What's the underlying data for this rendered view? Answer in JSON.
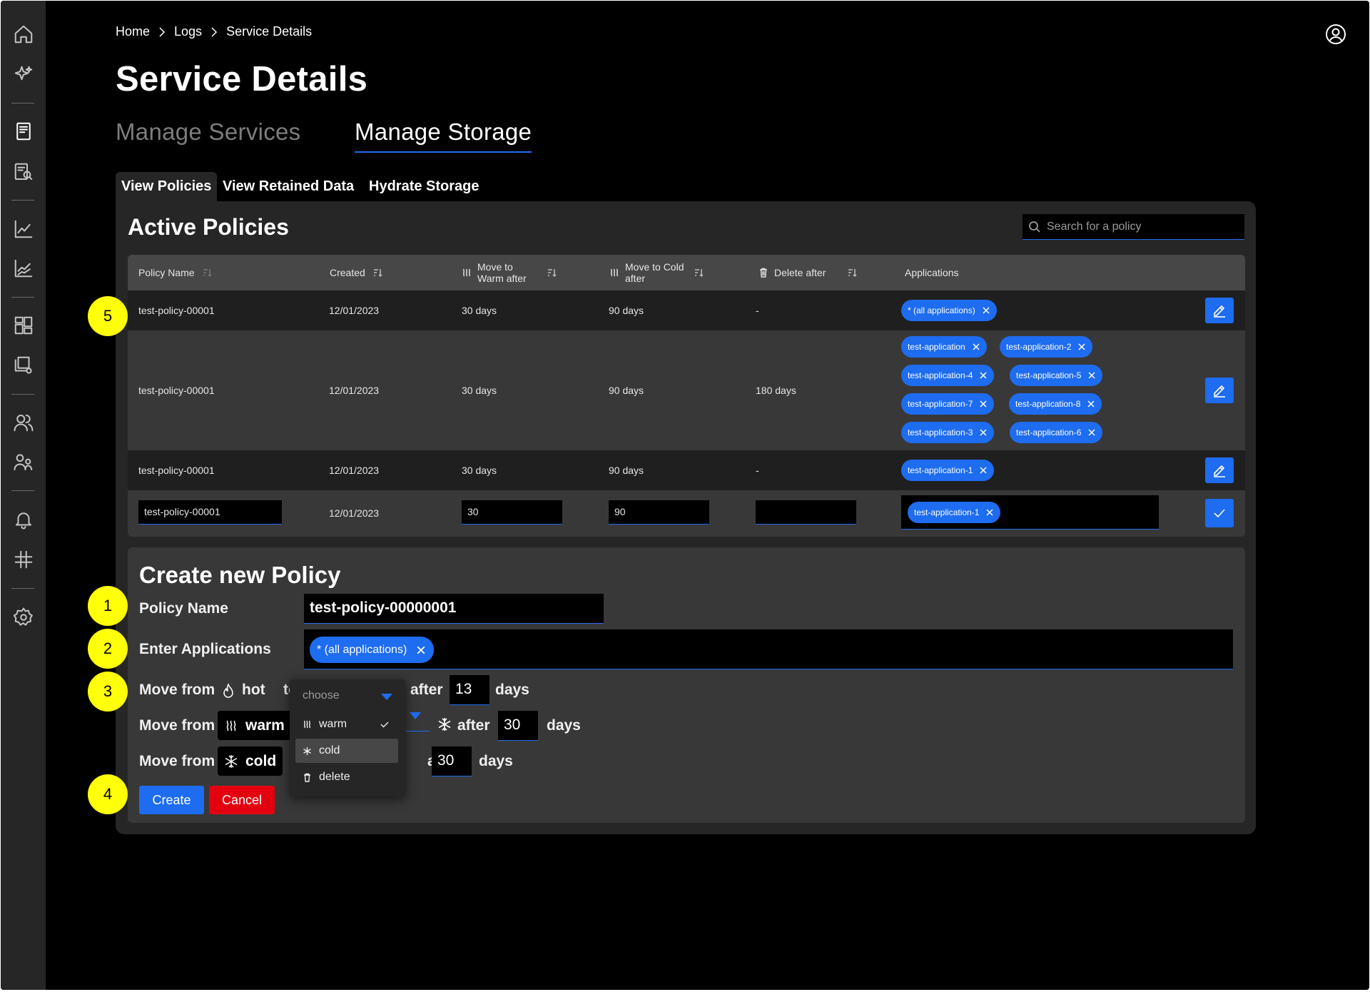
{
  "breadcrumb": [
    "Home",
    "Logs",
    "Service Details"
  ],
  "page_title": "Service Details",
  "main_tabs": [
    "Manage Services",
    "Manage Storage"
  ],
  "sub_tabs": [
    "View Policies",
    "View Retained Data",
    "Hydrate Storage"
  ],
  "active_policies": {
    "title": "Active Policies",
    "search_placeholder": "Search for a policy",
    "columns": {
      "policy_name": "Policy Name",
      "created": "Created",
      "warm_line1": "Move to",
      "warm_line2": "Warm after",
      "cold_line1": "Move to Cold",
      "cold_line2": "after",
      "delete_after": "Delete after",
      "applications": "Applications"
    },
    "rows": [
      {
        "name": "test-policy-00001",
        "created": "12/01/2023",
        "warm": "30 days",
        "cold": "90 days",
        "delete": "-",
        "apps": [
          "* (all applications)"
        ]
      },
      {
        "name": "test-policy-00001",
        "created": "12/01/2023",
        "warm": "30 days",
        "cold": "90 days",
        "delete": "180 days",
        "apps": [
          "test-application",
          "test-application-2",
          "test-application-4",
          "test-application-5",
          "test-application-7",
          "test-application-8",
          "test-application-3",
          "test-application-6"
        ]
      },
      {
        "name": "test-policy-00001",
        "created": "12/01/2023",
        "warm": "30 days",
        "cold": "90 days",
        "delete": "-",
        "apps": [
          "test-application-1"
        ]
      },
      {
        "name": "test-policy-00001",
        "created": "12/01/2023",
        "warm": "30",
        "cold": "90",
        "delete": "",
        "apps": [
          "test-application-1"
        ]
      }
    ]
  },
  "create_policy": {
    "title": "Create new Policy",
    "policy_name_label": "Policy Name",
    "policy_name_value": "test-policy-00000001",
    "applications_label": "Enter Applications",
    "applications": [
      "* (all applications)"
    ],
    "move_from": "Move from",
    "hot": "hot",
    "to": "to",
    "warm": "warm",
    "cold": "cold",
    "after": "after",
    "days": "days",
    "hot_after": "13",
    "warm_after": "30",
    "cold_after": "30",
    "create_label": "Create",
    "cancel_label": "Cancel"
  },
  "dropdown": {
    "placeholder": "choose",
    "options": [
      "warm",
      "cold",
      "delete"
    ],
    "checked": "warm",
    "highlighted": "cold"
  },
  "callouts": [
    "1",
    "2",
    "3",
    "4",
    "5"
  ],
  "colors": {
    "accent": "#1e6cf0",
    "danger": "#e3000f",
    "callout": "#ffff0a",
    "panel": "#262626"
  }
}
